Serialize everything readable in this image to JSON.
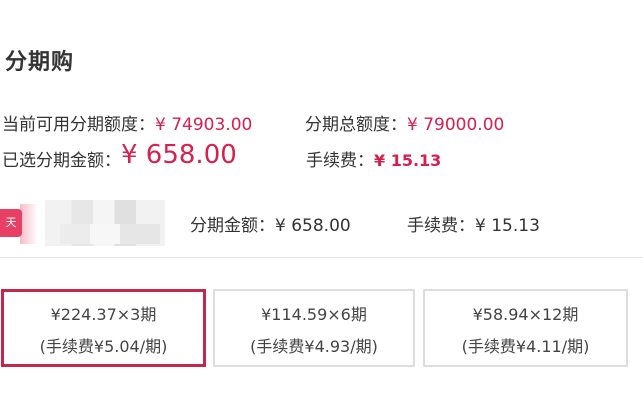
{
  "title": "分期购",
  "quota": {
    "available_label": "当前可用分期额度：",
    "available_value": "¥ 74903.00",
    "total_label": "分期总额度：",
    "total_value": "¥ 79000.00"
  },
  "selected": {
    "amount_label": "已选分期金额：",
    "amount_value": "¥ 658.00",
    "fee_label": "手续费：",
    "fee_value": "¥ 15.13"
  },
  "shop": {
    "badge": "天",
    "amount_label": "分期金额：",
    "amount_value": "¥ 658.00",
    "fee_label": "手续费：",
    "fee_value": "¥ 15.13"
  },
  "plans": [
    {
      "line1": "¥224.37×3期",
      "line2": "(手续费¥5.04/期)",
      "selected": true
    },
    {
      "line1": "¥114.59×6期",
      "line2": "(手续费¥4.93/期)",
      "selected": false
    },
    {
      "line1": "¥58.94×12期",
      "line2": "(手续费¥4.11/期)",
      "selected": false
    }
  ],
  "colors": {
    "accent": "#d6204e",
    "selected_border": "#c2274c",
    "text": "#333333"
  }
}
